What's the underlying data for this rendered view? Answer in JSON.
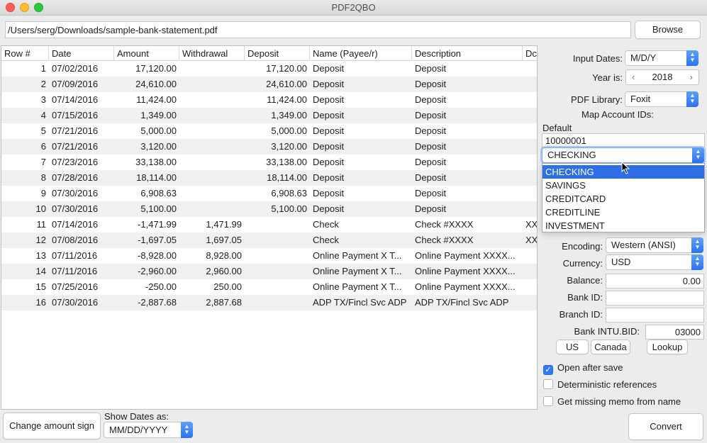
{
  "window": {
    "title": "PDF2QBO"
  },
  "file": {
    "path": "/Users/serg/Downloads/sample-bank-statement.pdf",
    "browse_label": "Browse"
  },
  "table": {
    "columns": [
      "Row #",
      "Date",
      "Amount",
      "Withdrawal",
      "Deposit",
      "Name (Payee/r)",
      "Description",
      "Dc"
    ],
    "rows": [
      [
        "1",
        "07/02/2016",
        "17,120.00",
        "",
        "17,120.00",
        "Deposit",
        "Deposit",
        ""
      ],
      [
        "2",
        "07/09/2016",
        "24,610.00",
        "",
        "24,610.00",
        "Deposit",
        "Deposit",
        ""
      ],
      [
        "3",
        "07/14/2016",
        "11,424.00",
        "",
        "11,424.00",
        "Deposit",
        "Deposit",
        ""
      ],
      [
        "4",
        "07/15/2016",
        "1,349.00",
        "",
        "1,349.00",
        "Deposit",
        "Deposit",
        ""
      ],
      [
        "5",
        "07/21/2016",
        "5,000.00",
        "",
        "5,000.00",
        "Deposit",
        "Deposit",
        ""
      ],
      [
        "6",
        "07/21/2016",
        "3,120.00",
        "",
        "3,120.00",
        "Deposit",
        "Deposit",
        ""
      ],
      [
        "7",
        "07/23/2016",
        "33,138.00",
        "",
        "33,138.00",
        "Deposit",
        "Deposit",
        ""
      ],
      [
        "8",
        "07/28/2016",
        "18,114.00",
        "",
        "18,114.00",
        "Deposit",
        "Deposit",
        ""
      ],
      [
        "9",
        "07/30/2016",
        "6,908.63",
        "",
        "6,908.63",
        "Deposit",
        "Deposit",
        ""
      ],
      [
        "10",
        "07/30/2016",
        "5,100.00",
        "",
        "5,100.00",
        "Deposit",
        "Deposit",
        ""
      ],
      [
        "11",
        "07/14/2016",
        "-1,471.99",
        "1,471.99",
        "",
        "Check",
        "Check #XXXX",
        "XX"
      ],
      [
        "12",
        "07/08/2016",
        "-1,697.05",
        "1,697.05",
        "",
        "Check",
        "Check #XXXX",
        "XX"
      ],
      [
        "13",
        "07/11/2016",
        "-8,928.00",
        "8,928.00",
        "",
        "Online Payment X T...",
        "Online Payment XXXX...",
        ""
      ],
      [
        "14",
        "07/11/2016",
        "-2,960.00",
        "2,960.00",
        "",
        "Online Payment X T...",
        "Online Payment XXXX...",
        ""
      ],
      [
        "15",
        "07/25/2016",
        "-250.00",
        "250.00",
        "",
        "Online Payment X T...",
        "Online Payment XXXX...",
        ""
      ],
      [
        "16",
        "07/30/2016",
        "-2,887.68",
        "2,887.68",
        "",
        "ADP TX/Fincl Svc ADP",
        "ADP TX/Fincl Svc ADP",
        ""
      ]
    ]
  },
  "settings": {
    "input_dates_label": "Input Dates:",
    "input_dates_value": "M/D/Y",
    "year_label": "Year is:",
    "year_value": "2018",
    "pdf_library_label": "PDF Library:",
    "pdf_library_value": "Foxit",
    "map_accounts_label": "Map Account IDs:",
    "default_label": "Default",
    "account_id_value": "10000001",
    "account_type_value": "CHECKING",
    "account_type_options": [
      "CHECKING",
      "SAVINGS",
      "CREDITCARD",
      "CREDITLINE",
      "INVESTMENT"
    ],
    "encoding_label": "Encoding:",
    "encoding_value": "Western (ANSI)",
    "currency_label": "Currency:",
    "currency_value": "USD",
    "balance_label": "Balance:",
    "balance_value": "0.00",
    "bank_id_label": "Bank ID:",
    "bank_id_value": "",
    "branch_id_label": "Branch ID:",
    "branch_id_value": "",
    "intu_bid_label": "Bank INTU.BID:",
    "intu_bid_value": "03000",
    "us_label": "US",
    "canada_label": "Canada",
    "lookup_label": "Lookup",
    "open_after_save_label": "Open after save",
    "open_after_save_checked": true,
    "deterministic_label": "Deterministic references",
    "deterministic_checked": false,
    "missing_memo_label": "Get missing memo from name",
    "missing_memo_checked": false
  },
  "bottom": {
    "change_sign_label": "Change amount sign",
    "show_dates_label": "Show Dates as:",
    "show_dates_value": "MM/DD/YYYY",
    "convert_label": "Convert"
  },
  "colors": {
    "accent": "#2f6fe6",
    "row_alt": "#f0f0f0"
  }
}
